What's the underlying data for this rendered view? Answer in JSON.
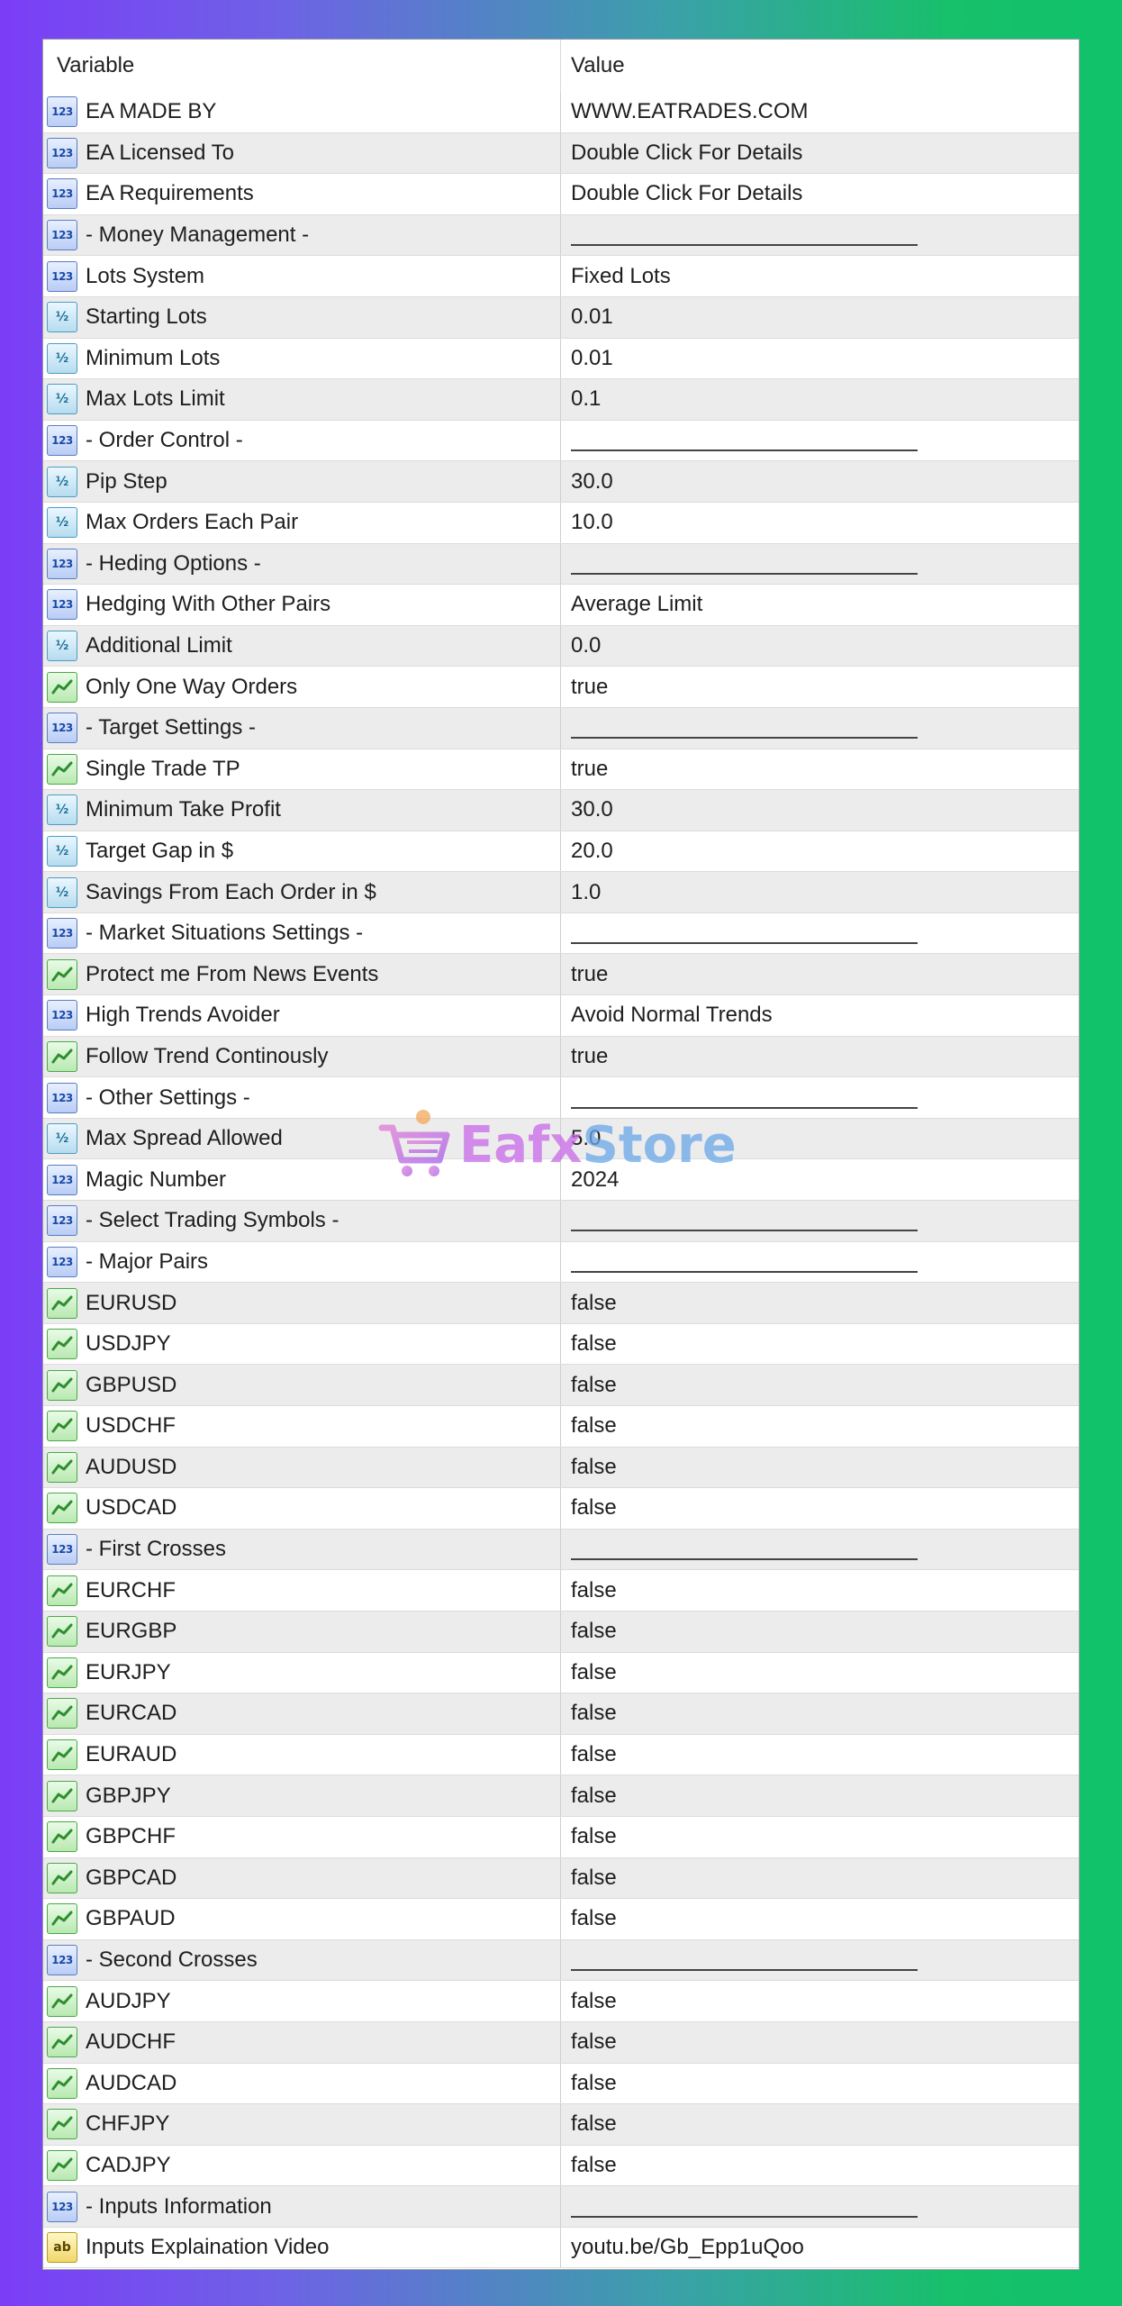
{
  "header": {
    "variable": "Variable",
    "value": "Value"
  },
  "rows": [
    {
      "type": "int",
      "variable": "EA MADE BY",
      "value": "WWW.EATRADES.COM"
    },
    {
      "type": "int",
      "variable": "EA Licensed To",
      "value": "Double Click For Details"
    },
    {
      "type": "int",
      "variable": "EA Requirements",
      "value": "Double Click For Details"
    },
    {
      "type": "int",
      "variable": "- Money Management -",
      "value": null
    },
    {
      "type": "int",
      "variable": "Lots System",
      "value": "Fixed Lots"
    },
    {
      "type": "double",
      "variable": "Starting Lots",
      "value": "0.01"
    },
    {
      "type": "double",
      "variable": "Minimum Lots",
      "value": "0.01"
    },
    {
      "type": "double",
      "variable": "Max Lots Limit",
      "value": "0.1"
    },
    {
      "type": "int",
      "variable": "- Order Control -",
      "value": null
    },
    {
      "type": "double",
      "variable": "Pip Step",
      "value": "30.0"
    },
    {
      "type": "double",
      "variable": "Max Orders Each Pair",
      "value": "10.0"
    },
    {
      "type": "int",
      "variable": "- Heding Options -",
      "value": null
    },
    {
      "type": "int",
      "variable": "Hedging With Other Pairs",
      "value": "Average Limit"
    },
    {
      "type": "double",
      "variable": "Additional Limit",
      "value": "0.0"
    },
    {
      "type": "bool",
      "variable": "Only One Way Orders",
      "value": "true"
    },
    {
      "type": "int",
      "variable": "- Target Settings -",
      "value": null
    },
    {
      "type": "bool",
      "variable": "Single Trade TP",
      "value": "true"
    },
    {
      "type": "double",
      "variable": "Minimum Take Profit",
      "value": "30.0"
    },
    {
      "type": "double",
      "variable": "Target Gap in $",
      "value": "20.0"
    },
    {
      "type": "double",
      "variable": "Savings From Each Order in $",
      "value": "1.0"
    },
    {
      "type": "int",
      "variable": "- Market Situations Settings -",
      "value": null
    },
    {
      "type": "bool",
      "variable": "Protect me From News Events",
      "value": "true"
    },
    {
      "type": "int",
      "variable": "High Trends Avoider",
      "value": "Avoid Normal Trends"
    },
    {
      "type": "bool",
      "variable": "Follow Trend Continously",
      "value": "true"
    },
    {
      "type": "int",
      "variable": "- Other Settings -",
      "value": null
    },
    {
      "type": "double",
      "variable": "Max Spread Allowed",
      "value": "5.0"
    },
    {
      "type": "int",
      "variable": "Magic Number",
      "value": "2024"
    },
    {
      "type": "int",
      "variable": "- Select Trading Symbols -",
      "value": null
    },
    {
      "type": "int",
      "variable": "- Major Pairs",
      "value": null
    },
    {
      "type": "bool",
      "variable": "EURUSD",
      "value": "false"
    },
    {
      "type": "bool",
      "variable": "USDJPY",
      "value": "false"
    },
    {
      "type": "bool",
      "variable": "GBPUSD",
      "value": "false"
    },
    {
      "type": "bool",
      "variable": "USDCHF",
      "value": "false"
    },
    {
      "type": "bool",
      "variable": "AUDUSD",
      "value": "false"
    },
    {
      "type": "bool",
      "variable": "USDCAD",
      "value": "false"
    },
    {
      "type": "int",
      "variable": "- First Crosses",
      "value": null
    },
    {
      "type": "bool",
      "variable": "EURCHF",
      "value": "false"
    },
    {
      "type": "bool",
      "variable": "EURGBP",
      "value": "false"
    },
    {
      "type": "bool",
      "variable": "EURJPY",
      "value": "false"
    },
    {
      "type": "bool",
      "variable": "EURCAD",
      "value": "false"
    },
    {
      "type": "bool",
      "variable": "EURAUD",
      "value": "false"
    },
    {
      "type": "bool",
      "variable": "GBPJPY",
      "value": "false"
    },
    {
      "type": "bool",
      "variable": "GBPCHF",
      "value": "false"
    },
    {
      "type": "bool",
      "variable": "GBPCAD",
      "value": "false"
    },
    {
      "type": "bool",
      "variable": "GBPAUD",
      "value": "false"
    },
    {
      "type": "int",
      "variable": "- Second Crosses",
      "value": null
    },
    {
      "type": "bool",
      "variable": "AUDJPY",
      "value": "false"
    },
    {
      "type": "bool",
      "variable": "AUDCHF",
      "value": "false"
    },
    {
      "type": "bool",
      "variable": "AUDCAD",
      "value": "false"
    },
    {
      "type": "bool",
      "variable": "CHFJPY",
      "value": "false"
    },
    {
      "type": "bool",
      "variable": "CADJPY",
      "value": "false"
    },
    {
      "type": "int",
      "variable": "- Inputs Information",
      "value": null
    },
    {
      "type": "string",
      "variable": "Inputs Explaination Video",
      "value": "youtu.be/Gb_Epp1uQoo"
    }
  ],
  "icons": {
    "int": "integer-type-icon",
    "double": "double-type-icon",
    "bool": "boolean-type-icon",
    "string": "string-type-icon"
  },
  "icon_glyphs": {
    "int": "123",
    "double": "½",
    "string": "ab"
  },
  "watermark": {
    "text_a": "Eafx",
    "text_b": "Store"
  },
  "colors": {
    "int_icon": "#1b4aa8",
    "double_icon": "#1a6f98",
    "bool_icon": "#2f8f2f",
    "string_icon": "#b89a20",
    "alt_row": "#ececec"
  }
}
